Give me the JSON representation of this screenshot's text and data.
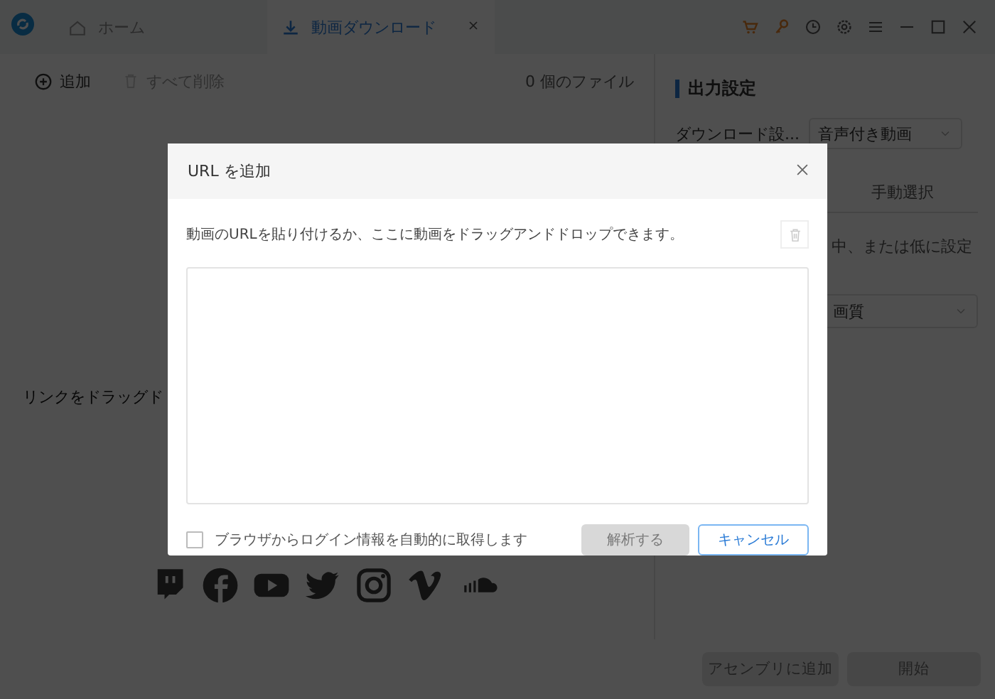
{
  "titlebar": {
    "tabs": [
      {
        "label": "ホーム",
        "selected": false
      },
      {
        "label": "動画ダウンロード",
        "selected": true
      }
    ]
  },
  "toolbar": {
    "add": "追加",
    "delete_all": {
      "label": "すべて削除",
      "disabled": true
    },
    "file_count": "0 個のファイル"
  },
  "drop_hint": "リンクをドラッグド",
  "output_settings": {
    "title": "出力設定",
    "download_label": "ダウンロード設...",
    "download_value": "音声付き動画",
    "tab": "手動選択",
    "note": "中、または低に設定",
    "quality_value": "画質"
  },
  "buttons": [
    {
      "label": "アセンブリに追加",
      "disabled": true
    },
    {
      "label": "開始",
      "disabled": true
    }
  ],
  "dialog": {
    "title": "URL を追加",
    "instruction": "動画のURLを貼り付けるか、ここに動画をドラッグアンドドロップできます。",
    "auto_login": {
      "label": "ブラウザからログイン情報を自動的に取得します",
      "checked": false
    },
    "buttons": [
      {
        "label": "解析する",
        "kind": "primary",
        "disabled": true
      },
      {
        "label": "キャンセル",
        "kind": "secondary",
        "disabled": false
      }
    ]
  }
}
